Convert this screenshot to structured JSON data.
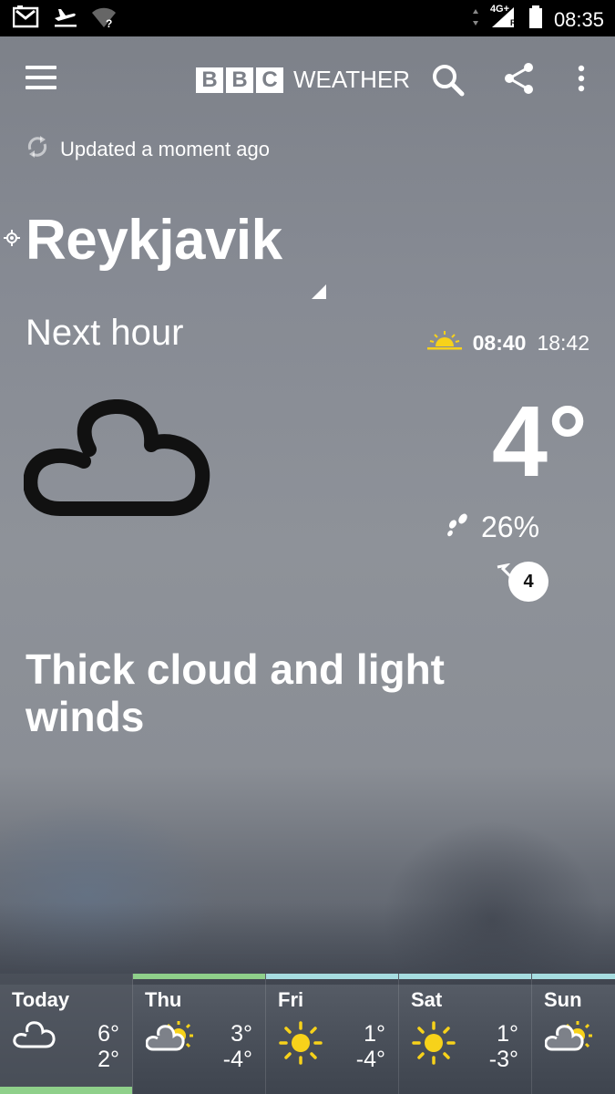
{
  "status_bar": {
    "time": "08:35",
    "network": "4G+",
    "roaming": "R"
  },
  "app": {
    "logo_letters": [
      "B",
      "B",
      "C"
    ],
    "logo_word": "WEATHER"
  },
  "updated": "Updated a moment ago",
  "location": "Reykjavik",
  "period": "Next hour",
  "sunrise": "08:40",
  "sunset": "18:42",
  "current": {
    "temperature": "4°",
    "precipitation": "26%",
    "wind_speed": "4",
    "summary": "Thick cloud and light winds",
    "icon": "cloud-icon"
  },
  "colors": {
    "today_accent": "#8fd08a",
    "thu_accent": "#8fd08a",
    "future_accent": "#a6dde0",
    "sun": "#f7d21a"
  },
  "forecast": [
    {
      "day": "Today",
      "high": "6°",
      "low": "2°",
      "icon": "cloud-icon"
    },
    {
      "day": "Thu",
      "high": "3°",
      "low": "-4°",
      "icon": "sun-cloud-icon"
    },
    {
      "day": "Fri",
      "high": "1°",
      "low": "-4°",
      "icon": "sun-icon"
    },
    {
      "day": "Sat",
      "high": "1°",
      "low": "-3°",
      "icon": "sun-icon"
    },
    {
      "day": "Sun",
      "high": "",
      "low": "",
      "icon": "sun-cloud-icon"
    }
  ]
}
